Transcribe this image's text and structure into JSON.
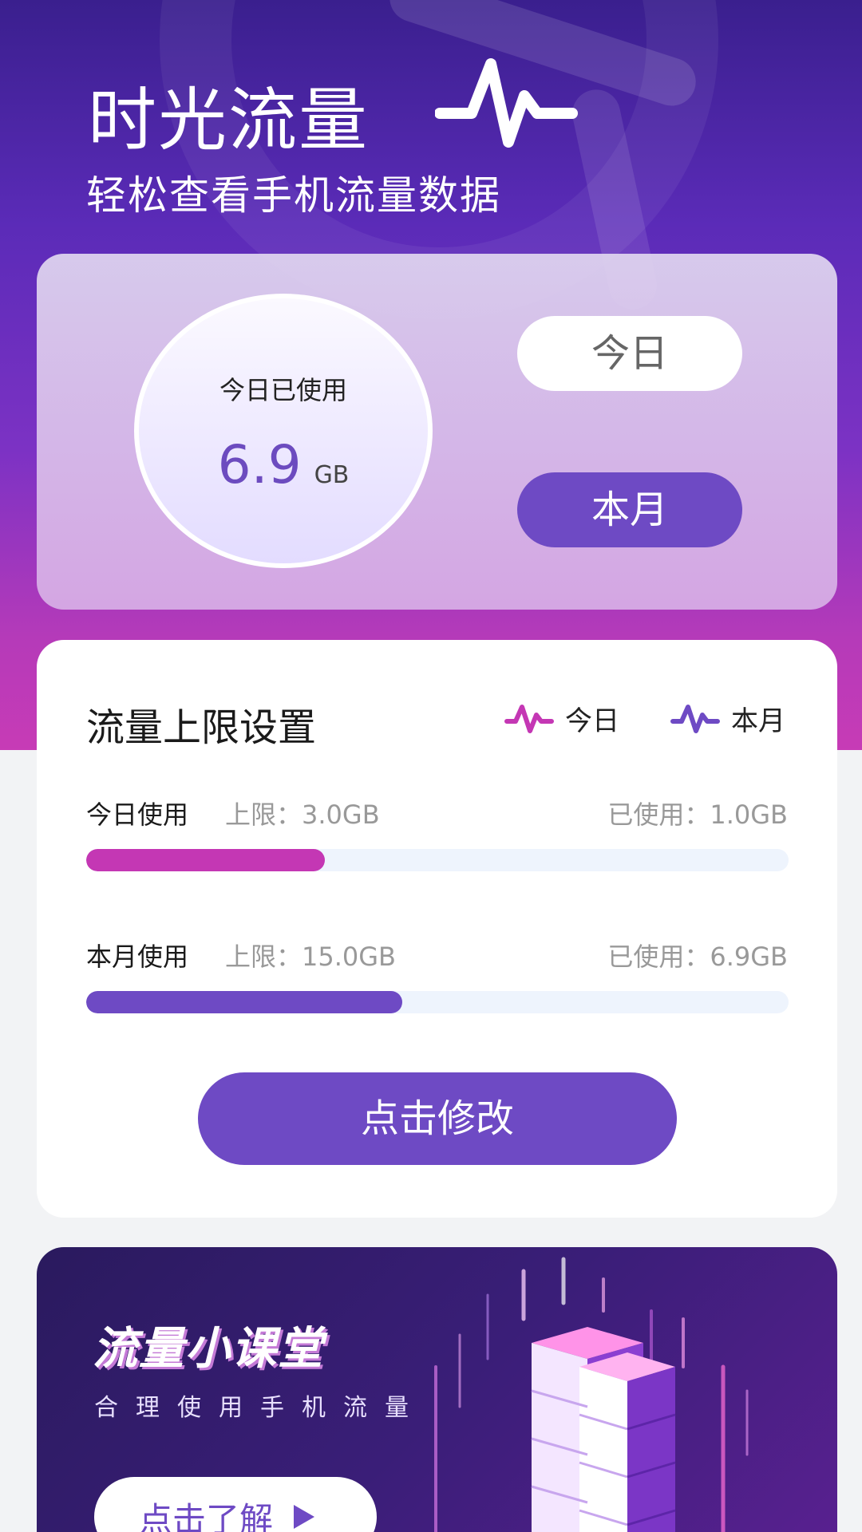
{
  "header": {
    "title": "时光流量",
    "subtitle": "轻松查看手机流量数据",
    "logo_icon": "pulse-wave-icon"
  },
  "usage_card": {
    "label": "今日已使用",
    "value": "6.9",
    "unit": "GB",
    "today_button": "今日",
    "month_button": "本月",
    "selected": "本月"
  },
  "limit_card": {
    "title": "流量上限设置",
    "legend": [
      {
        "label": "今日",
        "color": "#c437b4",
        "icon": "pulse-wave-icon"
      },
      {
        "label": "本月",
        "color": "#6e4ac4",
        "icon": "pulse-wave-icon"
      }
    ],
    "rows": [
      {
        "label": "今日使用",
        "limit": "上限：3.0GB",
        "used": "已使用：1.0GB",
        "fraction": 0.34,
        "color": "#c437b4"
      },
      {
        "label": "本月使用",
        "limit": "上限：15.0GB",
        "used": "已使用：6.9GB",
        "fraction": 0.45,
        "color": "#6e4ac4"
      }
    ],
    "edit_button": "点击修改"
  },
  "banner": {
    "title": "流量小课堂",
    "subtitle": "合理使用手机流量",
    "button": "点击了解",
    "button_icon": "play-icon"
  },
  "colors": {
    "accent_purple": "#6e4ac4",
    "accent_magenta": "#c437b4"
  }
}
